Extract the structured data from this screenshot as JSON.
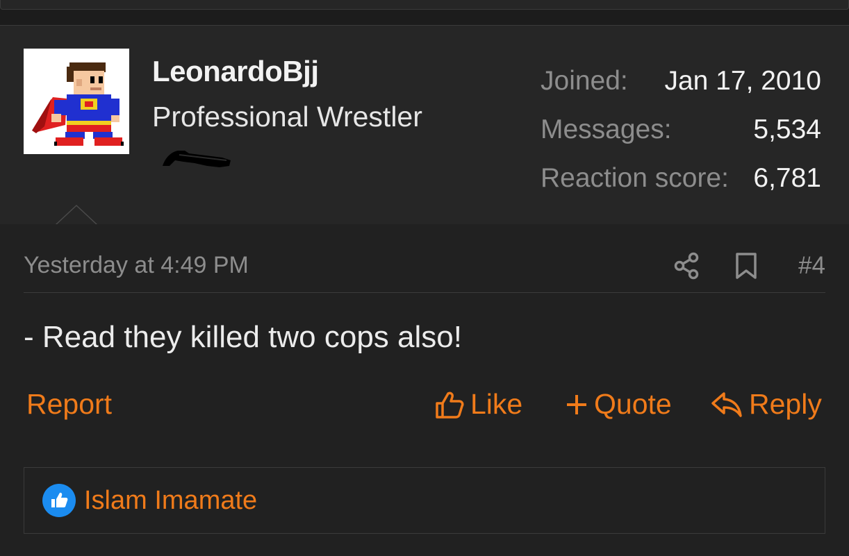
{
  "post": {
    "user": {
      "username": "LeonardoBjj",
      "title": "Professional Wrestler",
      "stats": [
        {
          "key": "Joined:",
          "value": "Jan 17, 2010"
        },
        {
          "key": "Messages:",
          "value": "5,534"
        },
        {
          "key": "Reaction score:",
          "value": "6,781"
        }
      ]
    },
    "timestamp": "Yesterday at 4:49 PM",
    "post_number": "#4",
    "message": "- Read they killed two cops also!",
    "actions": {
      "report": "Report",
      "like": "Like",
      "quote": "Quote",
      "reply": "Reply"
    },
    "reactions": {
      "type_icon": "thumbs-up-icon",
      "users": "Islam Imamate"
    }
  },
  "colors": {
    "accent": "#f07b1a",
    "reaction_badge": "#1b8cf0",
    "background": "#262626"
  },
  "icons": {
    "share": "share-icon",
    "bookmark": "bookmark-icon",
    "like": "thumbs-up-icon",
    "quote": "plus-icon",
    "reply": "reply-arrow-icon"
  }
}
